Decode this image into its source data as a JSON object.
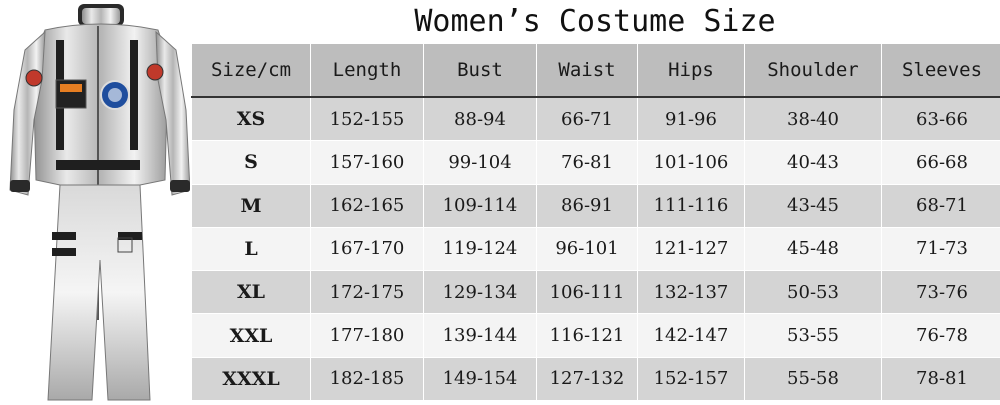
{
  "title": "Women’s Costume Size",
  "image": {
    "subject": "silver-astronaut-jumpsuit"
  },
  "table": {
    "headers": [
      "Size/cm",
      "Length",
      "Bust",
      "Waist",
      "Hips",
      "Shoulder",
      "Sleeves"
    ],
    "rows": [
      [
        "XS",
        "152-155",
        "88-94",
        "66-71",
        "91-96",
        "38-40",
        "63-66"
      ],
      [
        "S",
        "157-160",
        "99-104",
        "76-81",
        "101-106",
        "40-43",
        "66-68"
      ],
      [
        "M",
        "162-165",
        "109-114",
        "86-91",
        "111-116",
        "43-45",
        "68-71"
      ],
      [
        "L",
        "167-170",
        "119-124",
        "96-101",
        "121-127",
        "45-48",
        "71-73"
      ],
      [
        "XL",
        "172-175",
        "129-134",
        "106-111",
        "132-137",
        "50-53",
        "73-76"
      ],
      [
        "XXL",
        "177-180",
        "139-144",
        "116-121",
        "142-147",
        "53-55",
        "76-78"
      ],
      [
        "XXXL",
        "182-185",
        "149-154",
        "127-132",
        "152-157",
        "55-58",
        "78-81"
      ]
    ]
  },
  "colors": {
    "header_bg": "#bdbdbd",
    "row_dark": "#d4d4d4",
    "row_light": "#f4f4f4",
    "suit_silver": "#c8c8c8"
  }
}
